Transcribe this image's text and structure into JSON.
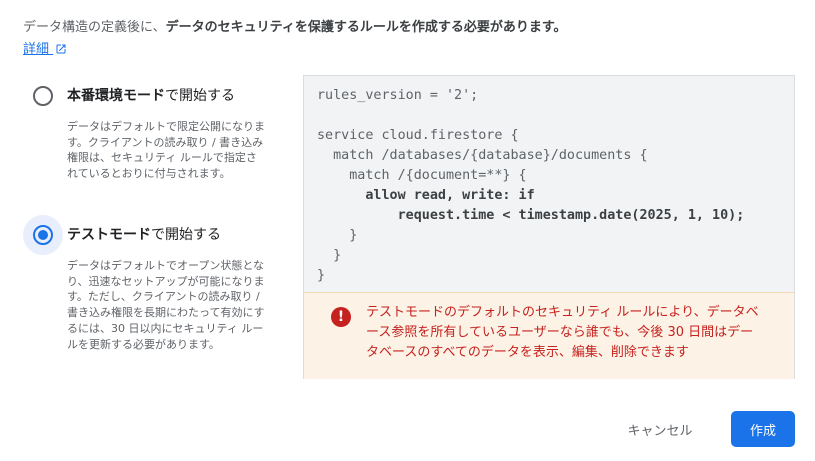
{
  "intro": {
    "prefix": "データ構造の定義後に、",
    "bold": "データのセキュリティを保護するルールを作成する必要があります。"
  },
  "detail_link": {
    "label": "詳細",
    "icon": "open-in-new-icon"
  },
  "options": {
    "production": {
      "title_bold": "本番環境モード",
      "title_rest": "で開始する",
      "description": "データはデフォルトで限定公開になります。クライアントの読み取り / 書き込み権限は、セキュリティ ルールで指定されているとおりに付与されます。",
      "selected": false
    },
    "test": {
      "title_bold": "テストモード",
      "title_rest": "で開始する",
      "description": "データはデフォルトでオープン状態となり、迅速なセットアップが可能になります。ただし、クライアントの読み取り / 書き込み権限を長期にわたって有効にするには、30 日以内にセキュリティ ルールを更新する必要があります。",
      "selected": true
    }
  },
  "code": {
    "l1": "rules_version = '2';",
    "l3": "service cloud.firestore {",
    "l4": "  match /databases/{database}/documents {",
    "l5": "    match /{document=**} {",
    "l6": "      allow read, write: if",
    "l7": "          request.time < timestamp.date(2025, 1, 10);",
    "l8": "    }",
    "l9": "  }",
    "l10": "}"
  },
  "warning": {
    "icon": "error-icon",
    "text": "テストモードのデフォルトのセキュリティ ルールにより、データベース参照を所有しているユーザーなら誰でも、今後 30 日間はデータベースのすべてのデータを表示、編集、削除できます",
    "color": "#c5221f"
  },
  "actions": {
    "cancel": "キャンセル",
    "create": "作成"
  },
  "colors": {
    "accent": "#1a73e8",
    "warning_bg": "#fdf2e6"
  }
}
